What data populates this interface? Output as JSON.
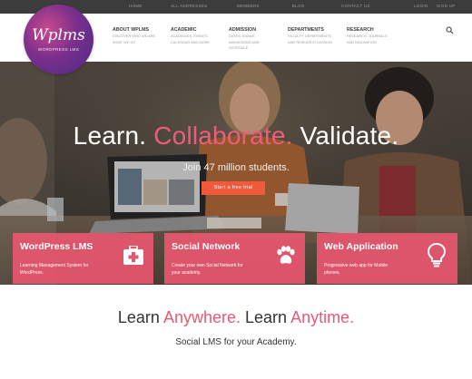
{
  "topbar": {
    "links": [
      "HOME",
      "ALL ADDRESSES",
      "MEMBERS",
      "BLOG",
      "CONTACT US"
    ],
    "login": "LOGIN",
    "signup": "SIGN UP"
  },
  "logo": {
    "brand": "Wplms",
    "tagline": "WORDPRESS LMS"
  },
  "nav": [
    {
      "title": "ABOUT WPLMS",
      "desc1": "DISCOVER WHO WE ARE",
      "desc2": "WHAT WE DO"
    },
    {
      "title": "ACADEMIC",
      "desc1": "ACADEMICS, EVENTS",
      "desc2": "CALENDAR AND MORE"
    },
    {
      "title": "ADMISSION",
      "desc1": "DATES, EXAMS",
      "desc2": "ADMISSIONS AND",
      "desc3": "SCHEDULE"
    },
    {
      "title": "DEPARTMENTS",
      "desc1": "FACULTY, DEPARTMENTS",
      "desc2": "AND RESEARCH DIVISION"
    },
    {
      "title": "RESEARCH",
      "desc1": "RESEARCH, JOURNALS",
      "desc2": "AND INNOVATION"
    }
  ],
  "hero": {
    "title_part1": "Learn.",
    "title_accent": "Collaborate.",
    "title_part2": "Validate.",
    "subtitle": "Join 47 million students.",
    "cta": "Start a free trial"
  },
  "cards": [
    {
      "title": "WordPress LMS",
      "line1": "Learning Management System for",
      "line2": "WordPress.",
      "icon": "medical-kit-icon"
    },
    {
      "title": "Social Network",
      "line1": "Create your own Social Network for",
      "line2": "your academy.",
      "icon": "paw-icon"
    },
    {
      "title": "Web Application",
      "line1": "Progressive web app for Mobile",
      "line2": "phones.",
      "icon": "lightbulb-icon"
    }
  ],
  "headline": {
    "part1": "Learn",
    "accent1": "Anywhere.",
    "part2": "Learn",
    "accent2": "Anytime."
  },
  "subline": "Social LMS for your Academy.",
  "colors": {
    "accent": "#e85a74",
    "cta": "#f05a3c",
    "card": "#e7566f",
    "topbar": "#3c3c3c"
  }
}
